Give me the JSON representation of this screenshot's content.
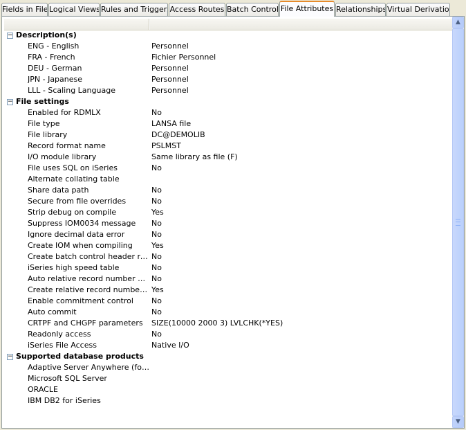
{
  "tabs": [
    {
      "label": "Fields in File",
      "active": false
    },
    {
      "label": "Logical Views",
      "active": false
    },
    {
      "label": "Rules and Triggers",
      "active": false
    },
    {
      "label": "Access Routes",
      "active": false
    },
    {
      "label": "Batch Control",
      "active": false
    },
    {
      "label": "File Attributes",
      "active": true
    },
    {
      "label": "Relationships",
      "active": false
    },
    {
      "label": "Virtual Derivation",
      "active": false
    }
  ],
  "groups": {
    "descriptions": {
      "expander": "⊟",
      "title": "Description(s)",
      "items": [
        {
          "name": "ENG - English",
          "value": "Personnel"
        },
        {
          "name": "FRA - French",
          "value": "Fichier Personnel"
        },
        {
          "name": "DEU - German",
          "value": "Personnel"
        },
        {
          "name": "JPN - Japanese",
          "value": "Personnel"
        },
        {
          "name": "LLL - Scaling Language",
          "value": "Personnel"
        }
      ]
    },
    "file_settings": {
      "expander": "⊟",
      "title": "File settings",
      "items": [
        {
          "name": "Enabled for RDMLX",
          "value": "No"
        },
        {
          "name": "File type",
          "value": "LANSA file"
        },
        {
          "name": "File library",
          "value": "DC@DEMOLIB"
        },
        {
          "name": "Record format name",
          "value": "PSLMST"
        },
        {
          "name": "I/O module library",
          "value": "Same library as file (F)"
        },
        {
          "name": "File uses SQL on iSeries",
          "value": "No"
        },
        {
          "name": "Alternate collating table",
          "value": ""
        },
        {
          "name": "Share data path",
          "value": "No"
        },
        {
          "name": "Secure from file overrides",
          "value": "No"
        },
        {
          "name": "Strip debug on compile",
          "value": "Yes"
        },
        {
          "name": "Suppress IOM0034 message",
          "value": "No"
        },
        {
          "name": "Ignore decimal data error",
          "value": "No"
        },
        {
          "name": "Create IOM when compiling",
          "value": "Yes"
        },
        {
          "name": "Create batch control header reco...",
          "value": "No"
        },
        {
          "name": "iSeries high speed table",
          "value": "No"
        },
        {
          "name": "Auto relative record number gen...",
          "value": "No"
        },
        {
          "name": "Create relative record number col...",
          "value": "Yes"
        },
        {
          "name": "Enable commitment control",
          "value": "No"
        },
        {
          "name": "Auto commit",
          "value": "No"
        },
        {
          "name": "CRTPF and CHGPF parameters",
          "value": "SIZE(10000 2000 3) LVLCHK(*YES)"
        },
        {
          "name": "Readonly access",
          "value": "No"
        },
        {
          "name": "iSeries File Access",
          "value": "Native I/O"
        }
      ]
    },
    "supported_db": {
      "expander": "⊟",
      "title": "Supported database products",
      "items": [
        {
          "name": "Adaptive Server Anywhere (for a...",
          "value": ""
        },
        {
          "name": "Microsoft SQL Server",
          "value": ""
        },
        {
          "name": "ORACLE",
          "value": ""
        },
        {
          "name": "IBM DB2 for iSeries",
          "value": ""
        }
      ]
    }
  },
  "scrollbar": {
    "up_glyph": "▲",
    "down_glyph": "▼"
  }
}
